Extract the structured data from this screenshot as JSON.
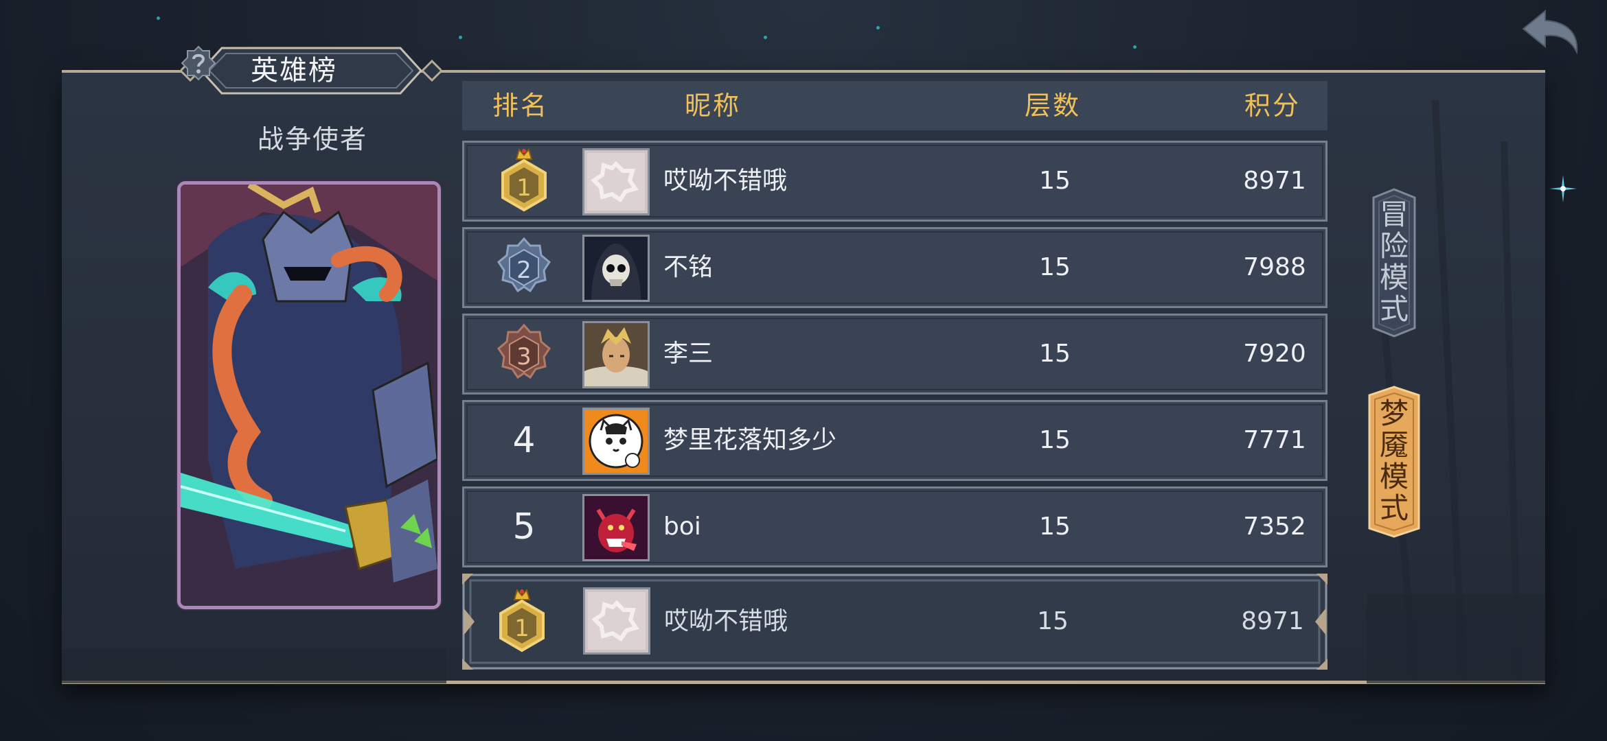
{
  "title": {
    "text": "英雄榜",
    "help_icon": "question-mark-icon"
  },
  "hero": {
    "name": "战争使者"
  },
  "table": {
    "headers": {
      "rank": "排名",
      "nickname": "昵称",
      "layers": "层数",
      "score": "积分"
    },
    "rows": [
      {
        "rank": "1",
        "nickname": "哎呦不错哦",
        "layers": "15",
        "score": "8971",
        "medal": "gold-crown-medal"
      },
      {
        "rank": "2",
        "nickname": "不铭",
        "layers": "15",
        "score": "7988",
        "medal": "silver-medal"
      },
      {
        "rank": "3",
        "nickname": "李三",
        "layers": "15",
        "score": "7920",
        "medal": "bronze-medal"
      },
      {
        "rank": "4",
        "nickname": "梦里花落知多少",
        "layers": "15",
        "score": "7771"
      },
      {
        "rank": "5",
        "nickname": "boi",
        "layers": "15",
        "score": "7352"
      }
    ],
    "self": {
      "rank": "1",
      "nickname": "哎呦不错哦",
      "layers": "15",
      "score": "8971"
    }
  },
  "modes": [
    {
      "label": "冒险模式",
      "active": false
    },
    {
      "label": "梦魇模式",
      "active": true
    }
  ],
  "colors": {
    "header_text": "#f0c05b",
    "accent_active_tab": "#e6a85a",
    "panel_border": "#b6ab94"
  }
}
